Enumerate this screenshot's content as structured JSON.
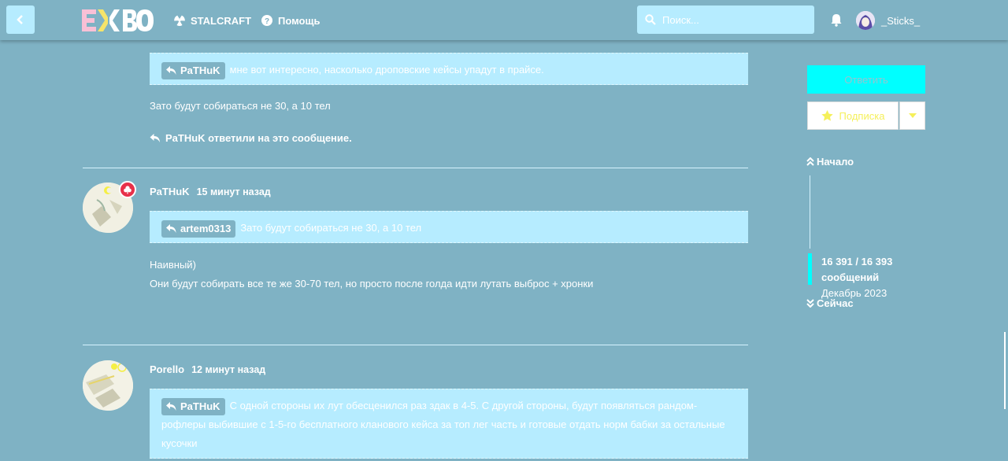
{
  "header": {
    "logo_text": "EXBO",
    "nav": [
      {
        "label": "STALCRAFT",
        "icon": "radiation-icon"
      },
      {
        "label": "Помощь",
        "icon": "question-icon"
      }
    ],
    "search_placeholder": "Поиск...",
    "username": "_Sticks_"
  },
  "thread": {
    "first_quote": {
      "author": "PaTHuK",
      "text": "мне вот интересно, насколько дроповские кейсы упадут в прайсе."
    },
    "first_body": "Зато будут собираться не 30, а 10 тел",
    "first_replies": "PaTHuK ответили на это сообщение.",
    "posts": [
      {
        "author": "PaTHuK",
        "time": "15 минут назад",
        "quote_author": "artem0313",
        "quote_text": "Зато будут собираться не 30, а 10 тел",
        "body_line1": "Наивный)",
        "body_line2": "Они будут собирать все те же 30-70 тел, но просто после голда идти лутать выброс + хронки"
      },
      {
        "author": "Porello",
        "time": "12 минут назад",
        "quote_author": "PaTHuK",
        "quote_text": "С одной стороны их лут обесценился раз здак в 4-5. С другой стороны, будут появляться рандом-рофлеры выбившие с 1-5-го бесплатного кланового кейса за топ лег часть и готовые отдать норм бабки за остальные кусочки"
      }
    ]
  },
  "sidebar": {
    "reply_label": "Ответить",
    "watch_label": "Подпиcка",
    "start_label": "Начало",
    "count_label": "16 391 / 16 393",
    "messages_label": "сообщений",
    "date_label": "Декабрь 2023",
    "now_label": "Сейчас"
  },
  "colors": {
    "background": "#7fb2c4",
    "quote": "#b6ecff",
    "accent": "#00ffff",
    "badge": "#e83049"
  }
}
